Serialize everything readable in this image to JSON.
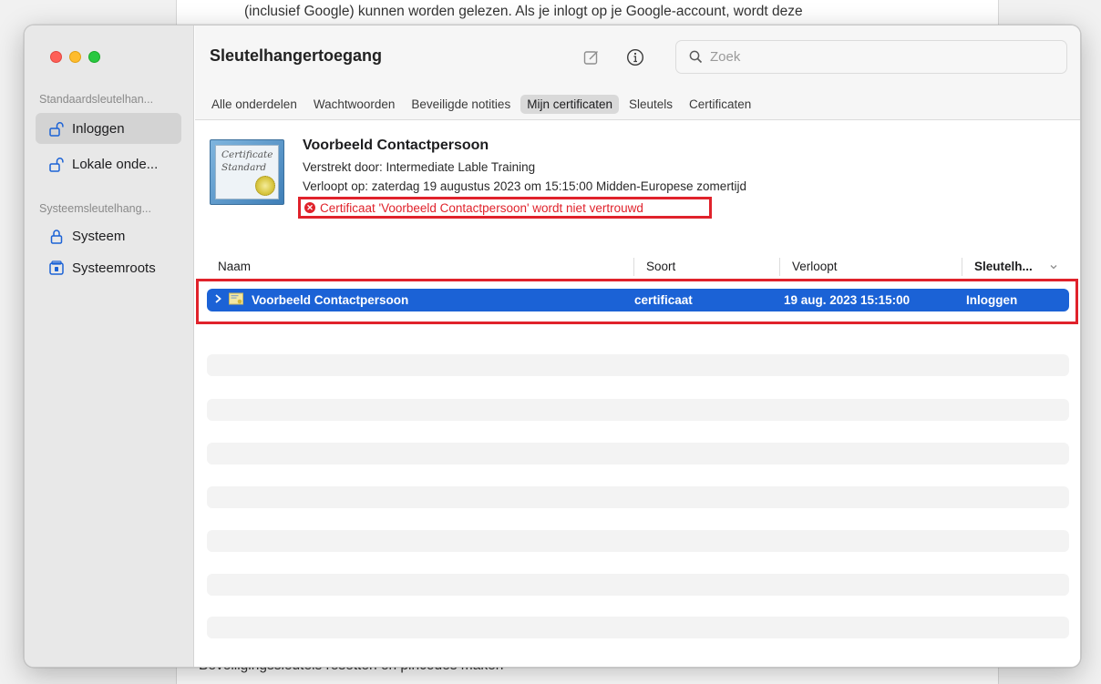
{
  "background_doc": {
    "top_text": "(inclusief Google) kunnen worden gelezen. Als je inlogt op je Google-account, wordt deze",
    "bottom_text": "Beveiligingssleutels resetten en pincodes maken"
  },
  "window": {
    "title": "Sleutelhangertoegang"
  },
  "sidebar": {
    "section1": "Standaardsleutelhan...",
    "items1": [
      {
        "label": "Inloggen",
        "icon": "unlocked-padlock-icon",
        "active": true
      },
      {
        "label": "Lokale onde...",
        "icon": "unlocked-padlock-icon",
        "active": false
      }
    ],
    "section2": "Systeemsleutelhang...",
    "items2": [
      {
        "label": "Systeem",
        "icon": "locked-padlock-icon",
        "active": false
      },
      {
        "label": "Systeemroots",
        "icon": "cabinet-lock-icon",
        "active": false
      }
    ]
  },
  "toolbar": {
    "search_placeholder": "Zoek",
    "edit_icon": "compose-icon",
    "info_icon": "info-icon"
  },
  "tabs": [
    {
      "label": "Alle onderdelen",
      "active": false
    },
    {
      "label": "Wachtwoorden",
      "active": false
    },
    {
      "label": "Beveiligde notities",
      "active": false
    },
    {
      "label": "Mijn certificaten",
      "active": true
    },
    {
      "label": "Sleutels",
      "active": false
    },
    {
      "label": "Certificaten",
      "active": false
    }
  ],
  "certificate": {
    "image_text_1": "Certificate",
    "image_text_2": "Standard",
    "name": "Voorbeeld Contactpersoon",
    "issued_by": "Verstrekt door: Intermediate Lable Training",
    "expires": "Verloopt op: zaterdag 19 augustus 2023 om 15:15:00 Midden-Europese zomertijd",
    "warning": "Certificaat 'Voorbeeld Contactpersoon' wordt niet vertrouwd"
  },
  "table": {
    "columns": [
      "Naam",
      "Soort",
      "Verloopt",
      "Sleutelh..."
    ],
    "rows": [
      {
        "name": "Voorbeeld Contactpersoon",
        "kind": "certificaat",
        "expires": "19 aug. 2023 15:15:00",
        "keychain": "Inloggen",
        "selected": true
      }
    ]
  },
  "colors": {
    "accent": "#1b62d6",
    "annotation": "#e0222b",
    "error_text": "#e0222b"
  }
}
